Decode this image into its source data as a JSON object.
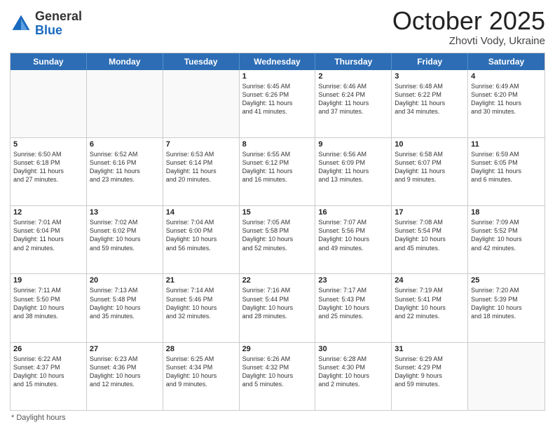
{
  "logo": {
    "general": "General",
    "blue": "Blue"
  },
  "header": {
    "month": "October 2025",
    "location": "Zhovti Vody, Ukraine"
  },
  "days": [
    "Sunday",
    "Monday",
    "Tuesday",
    "Wednesday",
    "Thursday",
    "Friday",
    "Saturday"
  ],
  "footer": {
    "note": "* Daylight hours"
  },
  "weeks": [
    [
      {
        "day": "",
        "text": ""
      },
      {
        "day": "",
        "text": ""
      },
      {
        "day": "",
        "text": ""
      },
      {
        "day": "1",
        "text": "Sunrise: 6:45 AM\nSunset: 6:26 PM\nDaylight: 11 hours\nand 41 minutes."
      },
      {
        "day": "2",
        "text": "Sunrise: 6:46 AM\nSunset: 6:24 PM\nDaylight: 11 hours\nand 37 minutes."
      },
      {
        "day": "3",
        "text": "Sunrise: 6:48 AM\nSunset: 6:22 PM\nDaylight: 11 hours\nand 34 minutes."
      },
      {
        "day": "4",
        "text": "Sunrise: 6:49 AM\nSunset: 6:20 PM\nDaylight: 11 hours\nand 30 minutes."
      }
    ],
    [
      {
        "day": "5",
        "text": "Sunrise: 6:50 AM\nSunset: 6:18 PM\nDaylight: 11 hours\nand 27 minutes."
      },
      {
        "day": "6",
        "text": "Sunrise: 6:52 AM\nSunset: 6:16 PM\nDaylight: 11 hours\nand 23 minutes."
      },
      {
        "day": "7",
        "text": "Sunrise: 6:53 AM\nSunset: 6:14 PM\nDaylight: 11 hours\nand 20 minutes."
      },
      {
        "day": "8",
        "text": "Sunrise: 6:55 AM\nSunset: 6:12 PM\nDaylight: 11 hours\nand 16 minutes."
      },
      {
        "day": "9",
        "text": "Sunrise: 6:56 AM\nSunset: 6:09 PM\nDaylight: 11 hours\nand 13 minutes."
      },
      {
        "day": "10",
        "text": "Sunrise: 6:58 AM\nSunset: 6:07 PM\nDaylight: 11 hours\nand 9 minutes."
      },
      {
        "day": "11",
        "text": "Sunrise: 6:59 AM\nSunset: 6:05 PM\nDaylight: 11 hours\nand 6 minutes."
      }
    ],
    [
      {
        "day": "12",
        "text": "Sunrise: 7:01 AM\nSunset: 6:04 PM\nDaylight: 11 hours\nand 2 minutes."
      },
      {
        "day": "13",
        "text": "Sunrise: 7:02 AM\nSunset: 6:02 PM\nDaylight: 10 hours\nand 59 minutes."
      },
      {
        "day": "14",
        "text": "Sunrise: 7:04 AM\nSunset: 6:00 PM\nDaylight: 10 hours\nand 56 minutes."
      },
      {
        "day": "15",
        "text": "Sunrise: 7:05 AM\nSunset: 5:58 PM\nDaylight: 10 hours\nand 52 minutes."
      },
      {
        "day": "16",
        "text": "Sunrise: 7:07 AM\nSunset: 5:56 PM\nDaylight: 10 hours\nand 49 minutes."
      },
      {
        "day": "17",
        "text": "Sunrise: 7:08 AM\nSunset: 5:54 PM\nDaylight: 10 hours\nand 45 minutes."
      },
      {
        "day": "18",
        "text": "Sunrise: 7:09 AM\nSunset: 5:52 PM\nDaylight: 10 hours\nand 42 minutes."
      }
    ],
    [
      {
        "day": "19",
        "text": "Sunrise: 7:11 AM\nSunset: 5:50 PM\nDaylight: 10 hours\nand 38 minutes."
      },
      {
        "day": "20",
        "text": "Sunrise: 7:13 AM\nSunset: 5:48 PM\nDaylight: 10 hours\nand 35 minutes."
      },
      {
        "day": "21",
        "text": "Sunrise: 7:14 AM\nSunset: 5:46 PM\nDaylight: 10 hours\nand 32 minutes."
      },
      {
        "day": "22",
        "text": "Sunrise: 7:16 AM\nSunset: 5:44 PM\nDaylight: 10 hours\nand 28 minutes."
      },
      {
        "day": "23",
        "text": "Sunrise: 7:17 AM\nSunset: 5:43 PM\nDaylight: 10 hours\nand 25 minutes."
      },
      {
        "day": "24",
        "text": "Sunrise: 7:19 AM\nSunset: 5:41 PM\nDaylight: 10 hours\nand 22 minutes."
      },
      {
        "day": "25",
        "text": "Sunrise: 7:20 AM\nSunset: 5:39 PM\nDaylight: 10 hours\nand 18 minutes."
      }
    ],
    [
      {
        "day": "26",
        "text": "Sunrise: 6:22 AM\nSunset: 4:37 PM\nDaylight: 10 hours\nand 15 minutes."
      },
      {
        "day": "27",
        "text": "Sunrise: 6:23 AM\nSunset: 4:36 PM\nDaylight: 10 hours\nand 12 minutes."
      },
      {
        "day": "28",
        "text": "Sunrise: 6:25 AM\nSunset: 4:34 PM\nDaylight: 10 hours\nand 9 minutes."
      },
      {
        "day": "29",
        "text": "Sunrise: 6:26 AM\nSunset: 4:32 PM\nDaylight: 10 hours\nand 5 minutes."
      },
      {
        "day": "30",
        "text": "Sunrise: 6:28 AM\nSunset: 4:30 PM\nDaylight: 10 hours\nand 2 minutes."
      },
      {
        "day": "31",
        "text": "Sunrise: 6:29 AM\nSunset: 4:29 PM\nDaylight: 9 hours\nand 59 minutes."
      },
      {
        "day": "",
        "text": ""
      }
    ]
  ]
}
